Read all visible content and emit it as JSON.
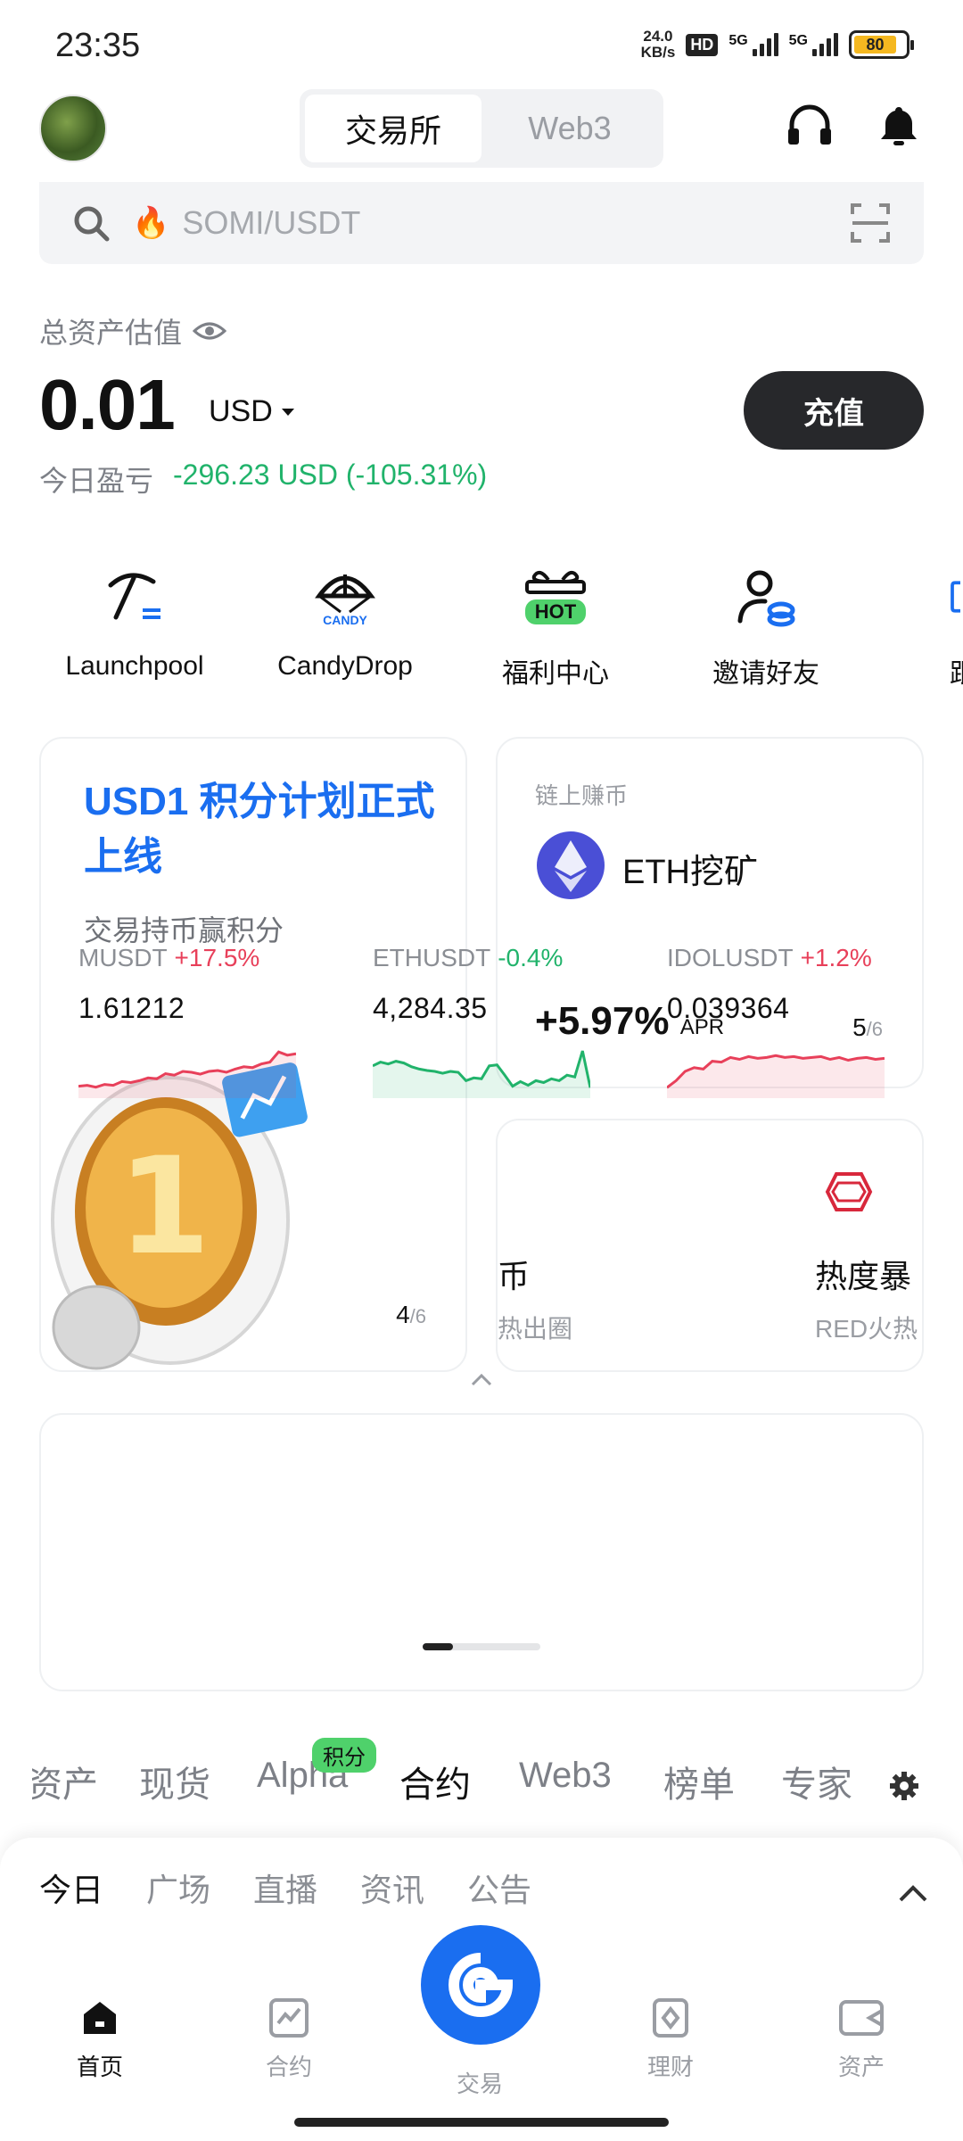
{
  "status_bar": {
    "time": "23:35",
    "net_speed_top": "24.0",
    "net_speed_bottom": "KB/s",
    "hd": "HD",
    "sig1": "5G",
    "sig2": "5G",
    "battery": "80"
  },
  "header": {
    "tabs": [
      {
        "label": "交易所"
      },
      {
        "label": "Web3"
      }
    ]
  },
  "search": {
    "placeholder": "SOMI/USDT"
  },
  "assets": {
    "label": "总资产估值",
    "value": "0.01",
    "unit": "USD",
    "deposit": "充值",
    "pnl_label": "今日盈亏",
    "pnl_value": "-296.23 USD",
    "pnl_pct": "(-105.31%)"
  },
  "shortcuts": [
    {
      "label": "Launchpool"
    },
    {
      "label": "CandyDrop"
    },
    {
      "label": "福利中心"
    },
    {
      "label": "邀请好友"
    },
    {
      "label": "跟"
    }
  ],
  "shortcut_hot": "HOT",
  "shortcut_candy": "CANDY",
  "promo": {
    "title": "USD1 积分计划正式上线",
    "subtitle": "交易持币赢积分",
    "page": "4",
    "total": "/6"
  },
  "earn": {
    "label": "链上赚币",
    "name": "ETH挖矿",
    "apr": "+5.97%",
    "apr_unit": "APR",
    "page": "5",
    "total": "/6"
  },
  "card3": {
    "left_title": "币",
    "left_sub": "热出圈",
    "right_title": "热度暴",
    "right_sub": "RED火热"
  },
  "market": [
    {
      "symbol": "MUSDT",
      "change": "+17.5%",
      "price": "1.61212",
      "trend": "up",
      "color": "#e8405a",
      "points": [
        0.18,
        0.2,
        0.16,
        0.22,
        0.2,
        0.28,
        0.26,
        0.3,
        0.36,
        0.34,
        0.45,
        0.42,
        0.5,
        0.48,
        0.44,
        0.5,
        0.52,
        0.48,
        0.55,
        0.6,
        0.58,
        0.66,
        0.7,
        0.92,
        0.85,
        0.88
      ]
    },
    {
      "symbol": "ETHUSDT",
      "change": "-0.4%",
      "price": "4,284.35",
      "trend": "down",
      "color": "#21b36b",
      "points": [
        0.62,
        0.7,
        0.66,
        0.72,
        0.68,
        0.6,
        0.55,
        0.52,
        0.5,
        0.46,
        0.5,
        0.48,
        0.3,
        0.36,
        0.34,
        0.62,
        0.64,
        0.42,
        0.18,
        0.28,
        0.2,
        0.3,
        0.26,
        0.34,
        0.3,
        0.42,
        0.38,
        0.94,
        0.15
      ]
    },
    {
      "symbol": "IDOLUSDT",
      "change": "+1.2%",
      "price": "0.039364",
      "trend": "up",
      "color": "#e8405a",
      "points": [
        0.15,
        0.3,
        0.5,
        0.58,
        0.55,
        0.72,
        0.7,
        0.8,
        0.76,
        0.82,
        0.78,
        0.8,
        0.84,
        0.8,
        0.82,
        0.78,
        0.8,
        0.82,
        0.76,
        0.8,
        0.74,
        0.78,
        0.8,
        0.76,
        0.78
      ]
    }
  ],
  "categories": [
    {
      "label": "资产"
    },
    {
      "label": "现货"
    },
    {
      "label": "Alpha"
    },
    {
      "label": "合约"
    },
    {
      "label": "Web3"
    },
    {
      "label": "榜单"
    },
    {
      "label": "专家"
    }
  ],
  "alpha_badge": "积分",
  "feed_tabs": [
    {
      "label": "今日"
    },
    {
      "label": "广场"
    },
    {
      "label": "直播"
    },
    {
      "label": "资讯"
    },
    {
      "label": "公告"
    }
  ],
  "bottom_nav": [
    {
      "label": "首页"
    },
    {
      "label": "合约"
    },
    {
      "label": "交易"
    },
    {
      "label": "理财"
    },
    {
      "label": "资产"
    }
  ],
  "colors": {
    "accent": "#1a6ef0",
    "up": "#e8405a",
    "down": "#21b36b"
  }
}
